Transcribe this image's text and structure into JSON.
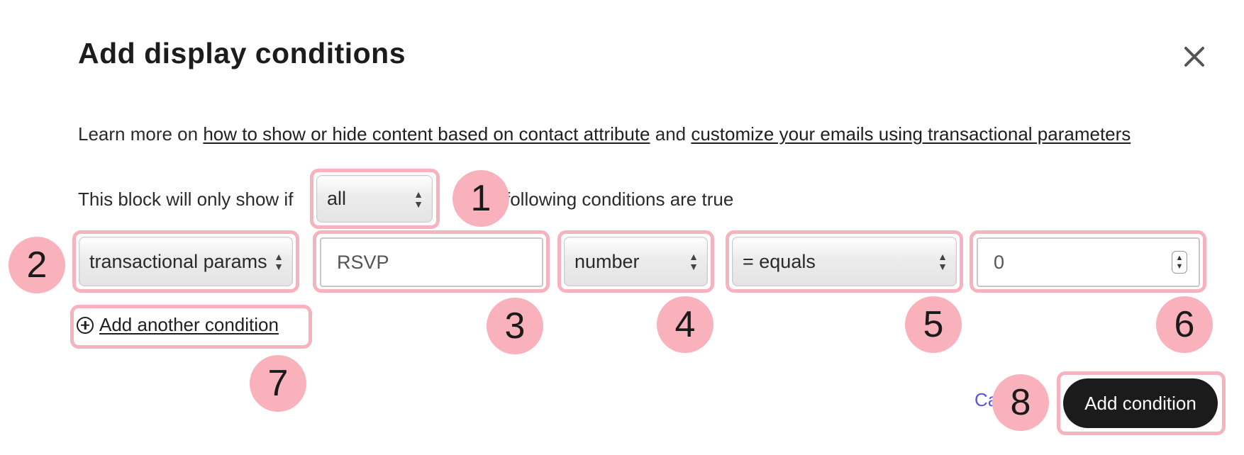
{
  "modal": {
    "title": "Add display conditions"
  },
  "learn": {
    "prefix": "Learn more on ",
    "link1": "how to show or hide content based on contact attribute",
    "middle": " and ",
    "link2": "customize your emails using transactional parameters"
  },
  "rule": {
    "prefix": "This block will only show if",
    "match_select": "all",
    "suffix": "following conditions are true"
  },
  "condition": {
    "source_select": "transactional params",
    "param_input": "RSVP",
    "type_select": "number",
    "operator_select": "= equals",
    "value_input": "0"
  },
  "actions": {
    "add_another": "Add another condition",
    "cancel": "Ca",
    "submit": "Add condition"
  },
  "annotations": [
    "1",
    "2",
    "3",
    "4",
    "5",
    "6",
    "7",
    "8"
  ],
  "colors": {
    "highlight": "#f7b3bd",
    "badge": "#f9b2bc",
    "link_accent": "#5b55e0",
    "primary_button": "#1b1b1b"
  }
}
